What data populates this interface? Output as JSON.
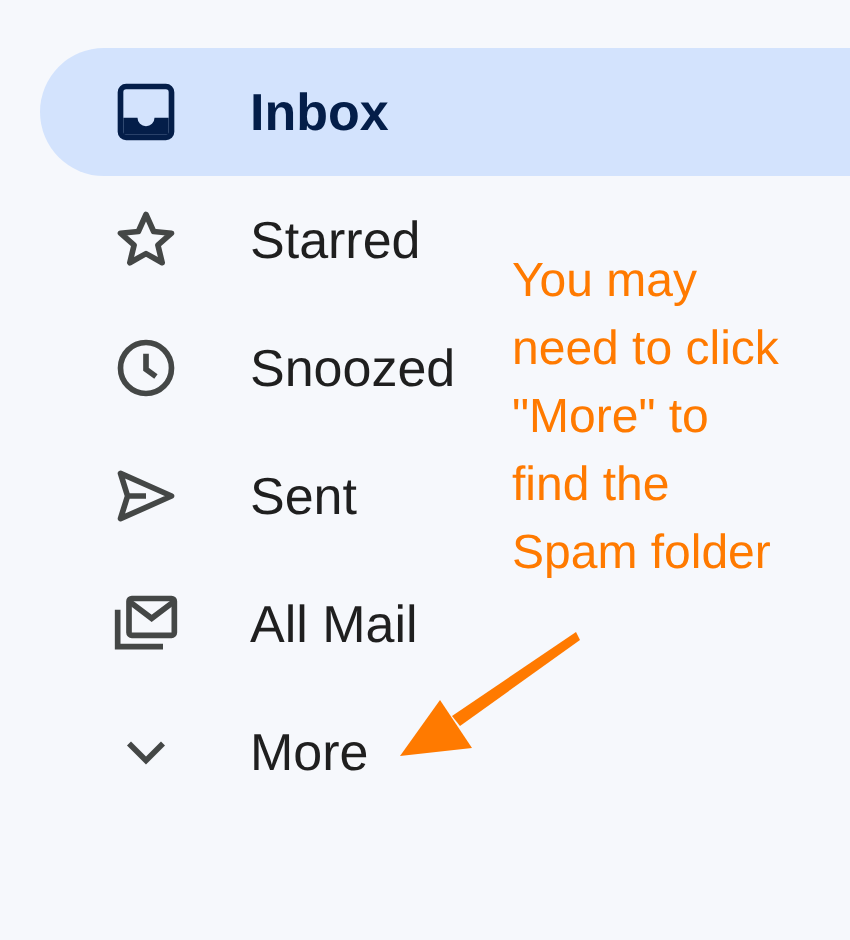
{
  "nav": [
    {
      "label": "Inbox",
      "kind": "inbox",
      "selected": true
    },
    {
      "label": "Starred",
      "kind": "star",
      "selected": false
    },
    {
      "label": "Snoozed",
      "kind": "clock",
      "selected": false
    },
    {
      "label": "Sent",
      "kind": "send",
      "selected": false
    },
    {
      "label": "All Mail",
      "kind": "allmail",
      "selected": false
    },
    {
      "label": "More",
      "kind": "more",
      "selected": false
    }
  ],
  "annotation": {
    "text": "You may\nneed to click\n\"More\" to\nfind the\nSpam folder",
    "color": "#ff7a00"
  }
}
